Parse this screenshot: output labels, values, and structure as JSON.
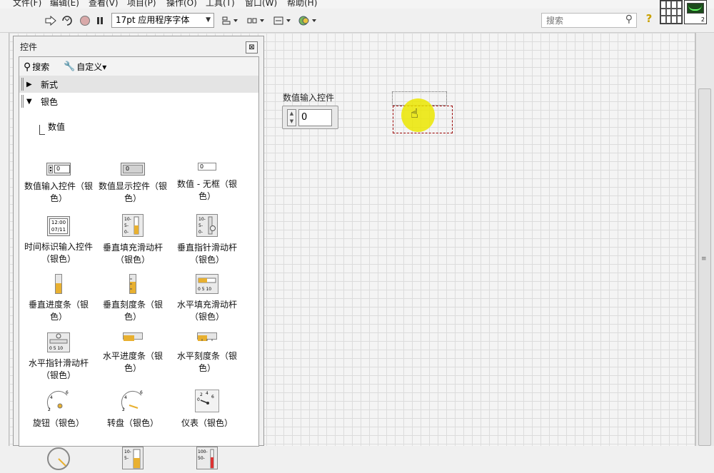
{
  "menu": {
    "items": [
      "文件(F)",
      "编辑(E)",
      "查看(V)",
      "项目(P)",
      "操作(O)",
      "工具(T)",
      "窗口(W)",
      "帮助(H)"
    ]
  },
  "toolbar": {
    "font_select": "17pt 应用程序字体",
    "search_placeholder": "搜索"
  },
  "vi_icon": {
    "number": "2"
  },
  "palette": {
    "title": "控件",
    "search_label": "搜索",
    "customize_label": "自定义▾",
    "categories": [
      {
        "label": "新式",
        "expanded": false
      },
      {
        "label": "银色",
        "expanded": true
      }
    ],
    "subcategory": "数值",
    "controls": [
      {
        "label": "数值输入控件（银色）",
        "icon": "numeric-control-icon",
        "text": "0"
      },
      {
        "label": "数值显示控件（银色）",
        "icon": "numeric-indicator-icon",
        "text": "0"
      },
      {
        "label": "数值 - 无框（银色）",
        "icon": "numeric-flat-icon",
        "text": "0"
      },
      {
        "label": "时间标识输入控件（银色）",
        "icon": "timestamp-icon",
        "text": "12:00 07/11"
      },
      {
        "label": "垂直填充滑动杆（银色）",
        "icon": "vertical-fill-slide-icon"
      },
      {
        "label": "垂直指针滑动杆（银色）",
        "icon": "vertical-pointer-slide-icon"
      },
      {
        "label": "垂直进度条（银色）",
        "icon": "vertical-progress-bar-icon"
      },
      {
        "label": "垂直刻度条（银色）",
        "icon": "vertical-graduated-bar-icon"
      },
      {
        "label": "水平填充滑动杆（银色）",
        "icon": "horizontal-fill-slide-icon"
      },
      {
        "label": "水平指针滑动杆（银色）",
        "icon": "horizontal-pointer-slide-icon"
      },
      {
        "label": "水平进度条（银色）",
        "icon": "horizontal-progress-bar-icon"
      },
      {
        "label": "水平刻度条（银色）",
        "icon": "horizontal-graduated-bar-icon"
      },
      {
        "label": "旋钮（银色）",
        "icon": "knob-icon"
      },
      {
        "label": "转盘（银色）",
        "icon": "dial-icon"
      },
      {
        "label": "仪表（银色）",
        "icon": "gauge-icon"
      }
    ]
  },
  "front_panel": {
    "numeric_label": "数值输入控件",
    "numeric_value": "0"
  },
  "colors": {
    "highlight": "#ebe600",
    "drop_outline": "#990000",
    "fill_yellow": "#e8b030"
  }
}
